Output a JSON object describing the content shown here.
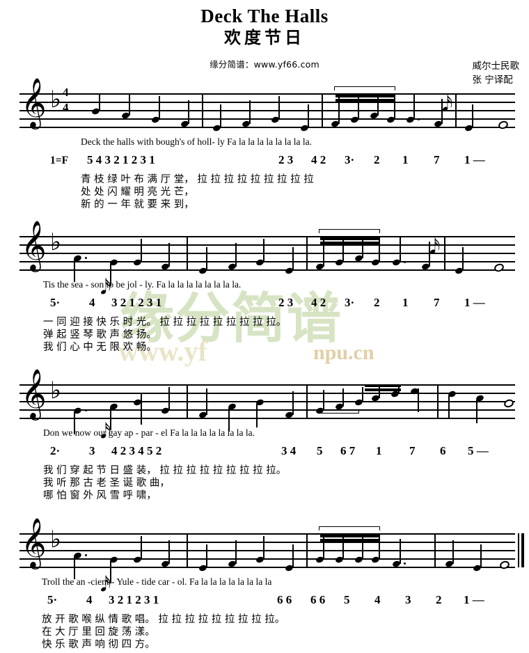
{
  "header": {
    "title_en": "Deck The Halls",
    "title_cn": "欢度节日",
    "site": "缘分简谱：www.yf66.com",
    "credit_origin": "威尔士民歌",
    "credit_translator": "张 宁译配"
  },
  "watermark": {
    "cn": "缘分简谱",
    "url": "www.yf",
    "url2": "npu.cn"
  },
  "score": {
    "key_label": "1=F",
    "clef": "treble-clef",
    "key_signature": "flat",
    "time_signature_top": "4",
    "time_signature_bottom": "4",
    "systems": [
      {
        "id": "system-1",
        "lyric_en": "Deck  the  halls  with  bough's of    holl- ly        Fa  la  la  la  la       la       la       la      la.",
        "jianpu_left": "5      4      3      2       1      2      3      1",
        "jianpu_right_a": "2 3",
        "jianpu_right_b": "4 2",
        "jianpu_right_c": "3·",
        "jianpu_right_d": "2",
        "jianpu_right_e": "1",
        "jianpu_right_f": "7",
        "jianpu_right_g": "1 —",
        "lyric_cn_1": "青   枝   绿   叶     布   满   厅 堂，    拉 拉 拉 拉 拉   拉    拉    拉    拉",
        "lyric_cn_2": "新   的   一   年     就   要   来 到，",
        "lyric_cn_3": "处   处   闪   耀     明   亮   光 芒，"
      },
      {
        "id": "system-2",
        "lyric_en": "Tis       the sea - son       to    be    jol -  ly.     Fa  la  la  la  la      la      la      la      la.",
        "jianpu_left": "5·",
        "jianpu_left_b": "4",
        "jianpu_left_c": "3      2       1      2      3      1",
        "jianpu_right_a": "2 3",
        "jianpu_right_b": "4 2",
        "jianpu_right_c": "3·",
        "jianpu_right_d": "2",
        "jianpu_right_e": "1",
        "jianpu_right_f": "7",
        "jianpu_right_g": "1 —",
        "lyric_cn_1": "一   同   迎   接     快   乐   时 光。    拉 拉 拉 拉 拉   拉    拉    拉   拉。",
        "lyric_cn_2": "弹   起   竖   琴     歌   声   悠 扬。",
        "lyric_cn_3": "我   们   心   中     无   限   欢 畅。"
      },
      {
        "id": "system-3",
        "lyric_en": "Don     we now   our       gay    ap - par -  el        Fa  la  la  la  la  la       la       la      la.",
        "jianpu_left": "2·",
        "jianpu_left_b": "3",
        "jianpu_left_c": "4      2        3      4      5      2",
        "jianpu_right_a": "3 4",
        "jianpu_right_b": "5",
        "jianpu_right_c": "6 7",
        "jianpu_right_d": "1",
        "jianpu_right_e": "7",
        "jianpu_right_f": "6",
        "jianpu_right_g": "5 —",
        "lyric_cn_1": "我   们  穿   起     节   日   盛   装，    拉 拉 拉 拉 拉 拉   拉    拉   拉。",
        "lyric_cn_2": "我   听  那   古     老   圣   诞   歌 曲，",
        "lyric_cn_3": "哪   怕  窗   外     风   雪   呼   啸，"
      },
      {
        "id": "system-4",
        "lyric_en": "Troll     the  an  -cient  -   Yule - tide    car -  ol.      Fa  la  la  la  la      la      la      la      la",
        "jianpu_left": "5·",
        "jianpu_left_b": "4",
        "jianpu_left_c": "3      2       1      2      3      1",
        "jianpu_right_a": "6 6",
        "jianpu_right_b": "6 6",
        "jianpu_right_c": "5",
        "jianpu_right_d": "4",
        "jianpu_right_e": "3",
        "jianpu_right_f": "2",
        "jianpu_right_g": "1 —",
        "lyric_cn_1": "放    开  歌   喉     纵   情   歌 唱。    拉 拉 拉 拉 拉   拉   拉   拉 拉。",
        "lyric_cn_2": "在    大  厅   里     回   旋   荡 漾。",
        "lyric_cn_3": "快    乐  歌   声     响   彻   四 方。"
      }
    ]
  }
}
